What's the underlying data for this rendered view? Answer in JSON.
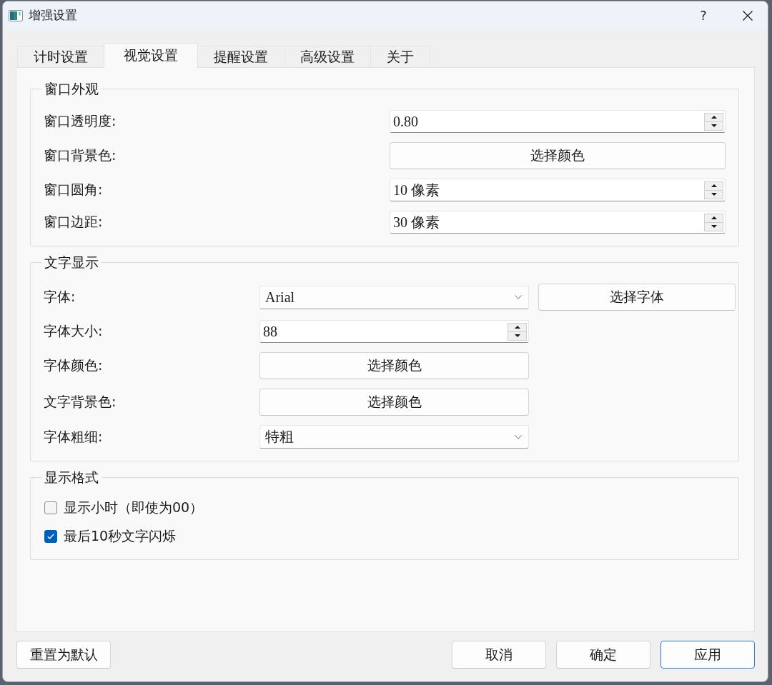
{
  "window": {
    "title": "增强设置",
    "help": "?"
  },
  "tabs": [
    {
      "label": "计时设置",
      "selected": false
    },
    {
      "label": "视觉设置",
      "selected": true
    },
    {
      "label": "提醒设置",
      "selected": false
    },
    {
      "label": "高级设置",
      "selected": false
    },
    {
      "label": "关于",
      "selected": false
    }
  ],
  "groups": [
    {
      "title": "窗口外观",
      "kind": "form",
      "rows": [
        {
          "label": "窗口透明度:",
          "controls": [
            {
              "kind": "spinbox",
              "value": "0.80"
            }
          ]
        },
        {
          "label": "窗口背景色:",
          "controls": [
            {
              "kind": "button",
              "text": "选择颜色"
            }
          ]
        },
        {
          "label": "窗口圆角:",
          "controls": [
            {
              "kind": "spinbox",
              "value": "10 像素"
            }
          ]
        },
        {
          "label": "窗口边距:",
          "controls": [
            {
              "kind": "spinbox",
              "value": "30 像素"
            }
          ]
        }
      ]
    },
    {
      "title": "文字显示",
      "kind": "form",
      "rows": [
        {
          "label": "字体:",
          "controls": [
            {
              "kind": "combobox",
              "value": "Arial"
            },
            {
              "kind": "button",
              "text": "选择字体"
            }
          ]
        },
        {
          "label": "字体大小:",
          "controls": [
            {
              "kind": "spinbox",
              "value": "88"
            }
          ]
        },
        {
          "label": "字体颜色:",
          "controls": [
            {
              "kind": "button",
              "text": "选择颜色"
            }
          ]
        },
        {
          "label": "文字背景色:",
          "controls": [
            {
              "kind": "button",
              "text": "选择颜色"
            }
          ]
        },
        {
          "label": "字体粗细:",
          "controls": [
            {
              "kind": "combobox",
              "value": "特粗"
            }
          ]
        }
      ]
    },
    {
      "title": "显示格式",
      "kind": "options",
      "rows": [
        {
          "label": "显示小时（即使为00）",
          "checked": false
        },
        {
          "label": "最后10秒文字闪烁",
          "checked": true
        }
      ]
    }
  ],
  "footer": {
    "left": [
      {
        "text": "重置为默认",
        "focused": false
      }
    ],
    "right": [
      {
        "text": "取消",
        "focused": false
      },
      {
        "text": "确定",
        "focused": false
      },
      {
        "text": "应用",
        "focused": true
      }
    ]
  }
}
